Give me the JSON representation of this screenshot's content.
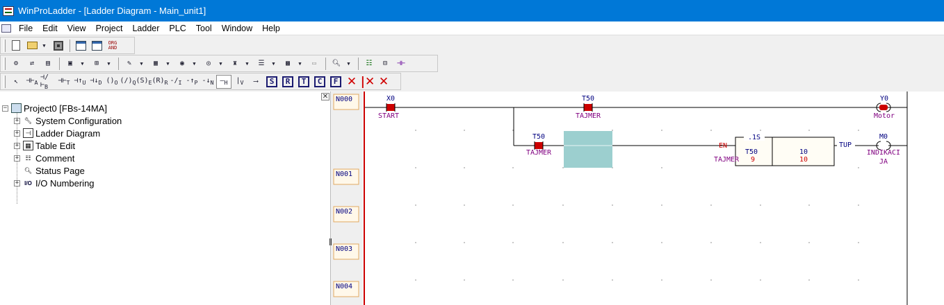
{
  "window": {
    "title": "WinProLadder - [Ladder Diagram - Main_unit1]",
    "app_icon": "winproladder-icon"
  },
  "menu": [
    "File",
    "Edit",
    "View",
    "Project",
    "Ladder",
    "PLC",
    "Tool",
    "Window",
    "Help"
  ],
  "toolbar1": {
    "org_and_label_top": "ORG",
    "org_and_label_bottom": "AND"
  },
  "toolbar3": {
    "contact_labels": [
      "A",
      "B",
      "T",
      "U",
      "D",
      "O",
      "Q",
      "E",
      "R",
      "I",
      "P",
      "N",
      "H",
      "V"
    ],
    "box_buttons": [
      "S",
      "R",
      "T",
      "C",
      "F"
    ]
  },
  "tree": {
    "root": "Project0 [FBs-14MA]",
    "items": [
      "System Configuration",
      "Ladder Diagram",
      "Table Edit",
      "Comment",
      "Status Page",
      "I/O Numbering"
    ],
    "io_icon_text": "I/O"
  },
  "ladder": {
    "rungs": [
      "N000",
      "N001",
      "N002",
      "N003",
      "N004"
    ],
    "contact_start": {
      "address": "X0",
      "comment": "START"
    },
    "contact_t50_top": {
      "address": "T50",
      "comment": "TAJMER"
    },
    "coil_motor": {
      "address": "Y0",
      "comment": "Motor"
    },
    "contact_t50_branch": {
      "address": "T50",
      "comment": "TAJMER"
    },
    "timer": {
      "en_label": "EN",
      "tup_label": "TUP",
      "resolution": ".1S",
      "name": "T50",
      "number": "9",
      "preset_top": "10",
      "preset_bottom": "10",
      "comment": "TAJMER"
    },
    "coil_m0": {
      "address": "M0",
      "comment_line1": "INDIKACI",
      "comment_line2": "JA"
    },
    "colors": {
      "rail": "#cc0000",
      "contact_red": "#cc0000",
      "address_text": "#000080",
      "comment_text": "#800080",
      "cursor": "#9ccfcf",
      "rung_label": "#000080",
      "timer_value": "#cc0000"
    }
  }
}
